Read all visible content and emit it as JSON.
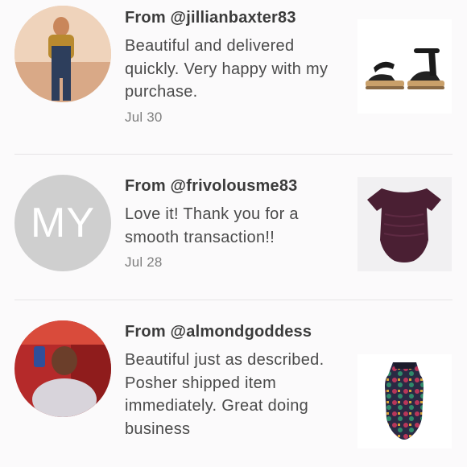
{
  "reviews": [
    {
      "from": "From @jillianbaxter83",
      "message": "Beautiful and delivered quickly. Very happy with my purchase.",
      "date": "Jul 30",
      "avatar": "photo",
      "product_icon": "sandal-icon"
    },
    {
      "from": "From @frivolousme83",
      "message": "Love it! Thank you for a smooth transaction!!",
      "date": "Jul 28",
      "avatar_initials": "MY",
      "product_icon": "swimsuit-icon"
    },
    {
      "from": "From @almondgoddess",
      "message": "Beautiful just as described. Posher shipped item immediately. Great doing business",
      "date": "",
      "avatar": "photo",
      "product_icon": "patterned-swimsuit-icon"
    }
  ],
  "colors": {
    "text": "#3b3b3b",
    "muted": "#7e7e7e",
    "divider": "#e6e4e6",
    "initials_bg": "#cfcfcf",
    "swimsuit": "#4a1f33"
  }
}
